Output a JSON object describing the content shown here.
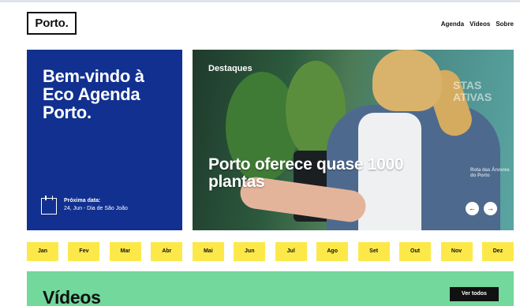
{
  "header": {
    "logo": "Porto.",
    "nav": [
      "Agenda",
      "Vídeos",
      "Sobre"
    ]
  },
  "welcome": {
    "title": "Bem-vindo à Eco Agenda Porto.",
    "next_date_label": "Próxima data:",
    "next_date_value": "24, Jun - Dia de São João",
    "icon": "calendar-icon"
  },
  "featured": {
    "section_label": "Destaques",
    "headline": "Porto oferece quase 1000 plantas",
    "sign_text": "STAS ATIVAS",
    "sign_small": "Rota das Árvores do Porto",
    "prev_icon": "arrow-left-icon",
    "next_icon": "arrow-right-icon"
  },
  "months": [
    "Jan",
    "Fev",
    "Mar",
    "Abr",
    "Mai",
    "Jun",
    "Jul",
    "Ago",
    "Set",
    "Out",
    "Nov",
    "Dez"
  ],
  "videos": {
    "title": "Vídeos",
    "view_all": "Ver todos"
  },
  "colors": {
    "welcome_bg": "#11308f",
    "month_bg": "#fde84a",
    "videos_bg": "#72d89b",
    "button_bg": "#111111"
  }
}
